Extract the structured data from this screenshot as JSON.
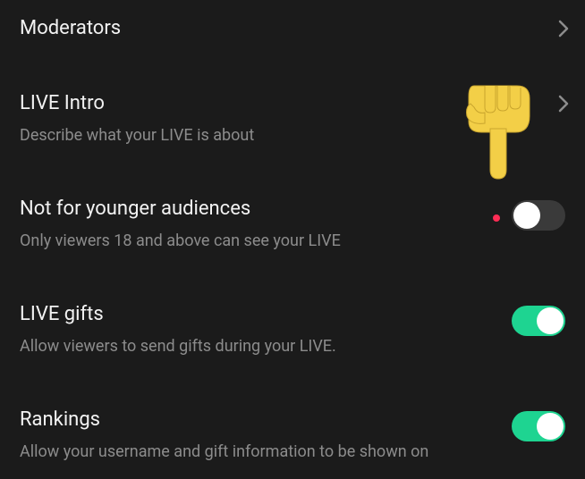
{
  "items": [
    {
      "title": "Moderators",
      "subtitle": "",
      "kind": "nav"
    },
    {
      "title": "LIVE Intro",
      "subtitle": "Describe what your LIVE is about",
      "kind": "nav"
    },
    {
      "title": "Not for younger audiences",
      "subtitle": "Only viewers 18 and above can see your LIVE",
      "kind": "toggle",
      "state": "off",
      "indicator": true
    },
    {
      "title": "LIVE gifts",
      "subtitle": "Allow viewers to send gifts during your LIVE.",
      "kind": "toggle",
      "state": "on"
    },
    {
      "title": "Rankings",
      "subtitle": "Allow your username and gift information to be shown on",
      "kind": "toggle",
      "state": "on"
    }
  ],
  "colors": {
    "bg": "#1b1b1b",
    "text": "#f2f2f2",
    "muted": "#8c8c8c",
    "toggle_on": "#1ed491",
    "toggle_off": "#3a3a3a",
    "indicator": "#ff2d55"
  },
  "overlay": {
    "icon": "pointing-down-hand-icon"
  }
}
